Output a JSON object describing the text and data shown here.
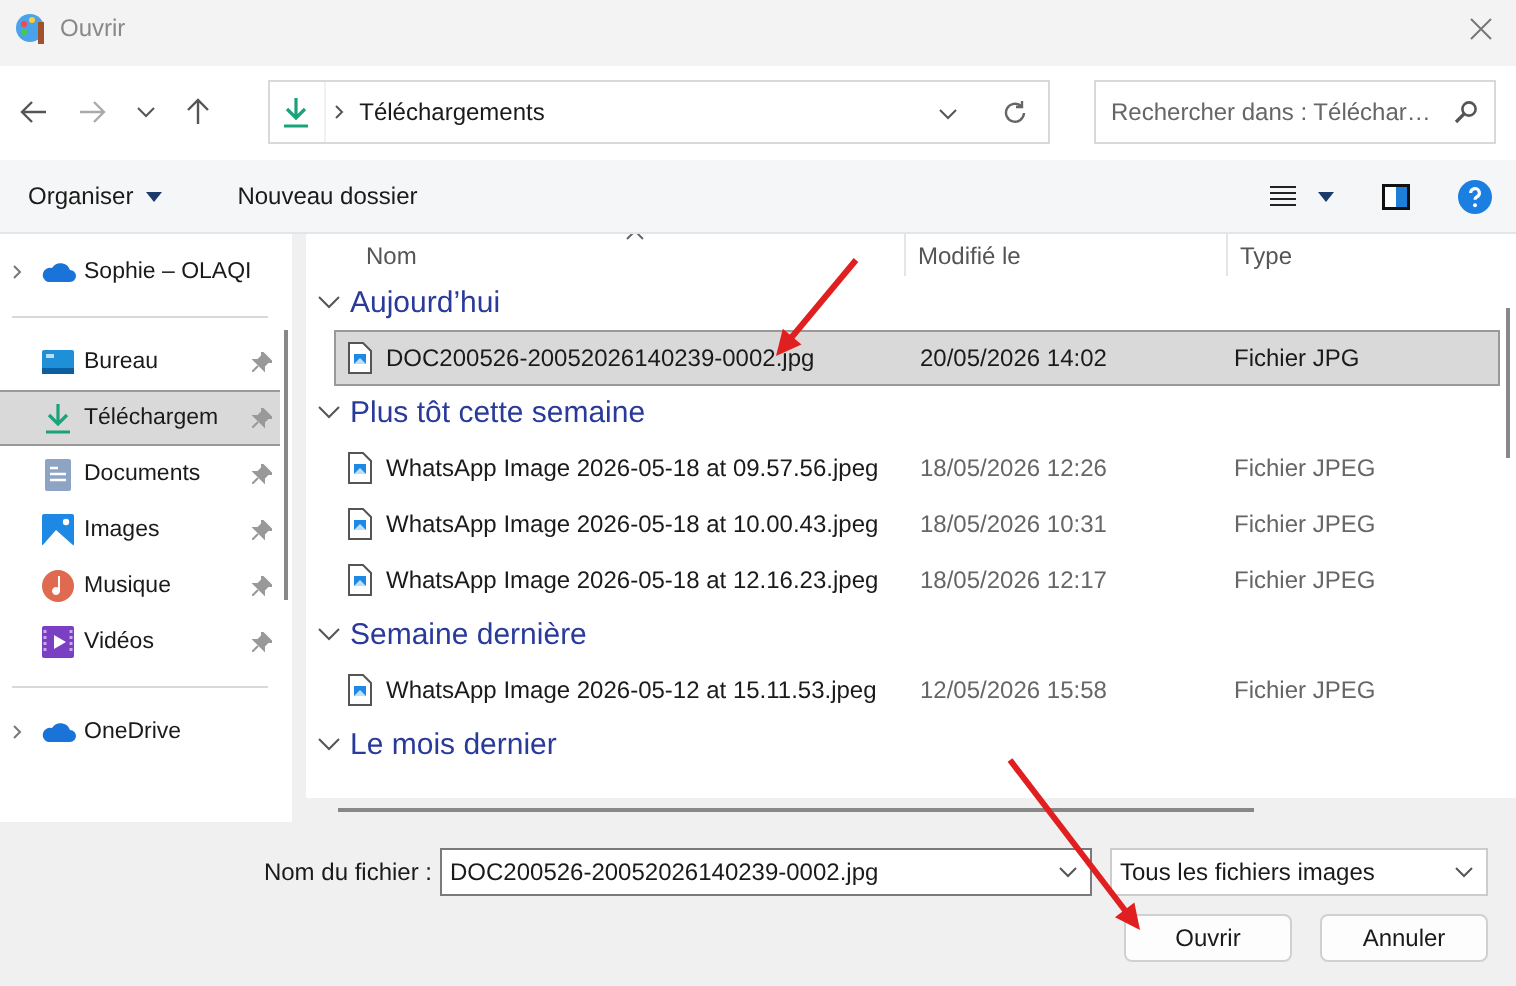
{
  "window": {
    "title": "Ouvrir"
  },
  "address": {
    "path": "Téléchargements"
  },
  "search": {
    "placeholder": "Rechercher dans : Téléchar…"
  },
  "command_bar": {
    "organize": "Organiser",
    "new_folder": "Nouveau dossier"
  },
  "sidebar": {
    "items": [
      {
        "label": "Sophie – OLAQI",
        "kind": "cloud",
        "selected": false,
        "pinned": false,
        "expandable": true,
        "section_start": false
      },
      {
        "label": "Bureau",
        "kind": "desktop",
        "selected": false,
        "pinned": true,
        "expandable": false,
        "section_start": true
      },
      {
        "label": "Téléchargem",
        "kind": "download",
        "selected": true,
        "pinned": true,
        "expandable": false,
        "section_start": false
      },
      {
        "label": "Documents",
        "kind": "documents",
        "selected": false,
        "pinned": true,
        "expandable": false,
        "section_start": false
      },
      {
        "label": "Images",
        "kind": "pictures",
        "selected": false,
        "pinned": true,
        "expandable": false,
        "section_start": false
      },
      {
        "label": "Musique",
        "kind": "music",
        "selected": false,
        "pinned": true,
        "expandable": false,
        "section_start": false
      },
      {
        "label": "Vidéos",
        "kind": "videos",
        "selected": false,
        "pinned": true,
        "expandable": false,
        "section_start": false
      },
      {
        "label": "OneDrive",
        "kind": "cloud",
        "selected": false,
        "pinned": false,
        "expandable": true,
        "section_start": true
      }
    ]
  },
  "file_list": {
    "columns": [
      "Nom",
      "Modifié le",
      "Type"
    ],
    "groups": [
      {
        "label": "Aujourd’hui",
        "expanded": true,
        "files": [
          {
            "name": "DOC200526-20052026140239-0002.jpg",
            "modified": "20/05/2026 14:02",
            "type": "Fichier JPG",
            "selected": true
          }
        ]
      },
      {
        "label": "Plus tôt cette semaine",
        "expanded": true,
        "files": [
          {
            "name": "WhatsApp Image 2026-05-18 at 09.57.56.jpeg",
            "modified": "18/05/2026 12:26",
            "type": "Fichier JPEG",
            "selected": false
          },
          {
            "name": "WhatsApp Image 2026-05-18 at 10.00.43.jpeg",
            "modified": "18/05/2026 10:31",
            "type": "Fichier JPEG",
            "selected": false
          },
          {
            "name": "WhatsApp Image 2026-05-18 at 12.16.23.jpeg",
            "modified": "18/05/2026 12:17",
            "type": "Fichier JPEG",
            "selected": false
          }
        ]
      },
      {
        "label": "Semaine dernière",
        "expanded": true,
        "files": [
          {
            "name": "WhatsApp Image 2026-05-12 at 15.11.53.jpeg",
            "modified": "12/05/2026 15:58",
            "type": "Fichier JPEG",
            "selected": false
          }
        ]
      },
      {
        "label": "Le mois dernier",
        "expanded": true
      }
    ]
  },
  "footer": {
    "filename_label": "Nom du fichier :",
    "filename": "DOC200526-20052026140239-0002.jpg",
    "filter": "Tous les fichiers images",
    "buttons": [
      "Ouvrir",
      "Annuler"
    ]
  }
}
